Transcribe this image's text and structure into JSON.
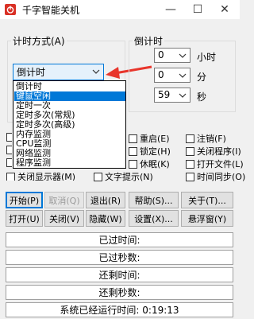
{
  "window": {
    "title": "千字智能关机",
    "min_glyph": "—",
    "max_glyph": "☐",
    "close_glyph": "✕"
  },
  "timing_mode": {
    "label": "计时方式(A)",
    "selected": "倒计时",
    "options": [
      "倒计时",
      "键鼠空闲",
      "定时一次",
      "定时多次(常规)",
      "定时多次(高级)",
      "内存监测",
      "CPU监测",
      "网络监测",
      "程序监测"
    ],
    "highlighted_index": 1
  },
  "countdown": {
    "label": "倒计时",
    "hours": {
      "value": "0",
      "unit": "小时"
    },
    "minutes": {
      "value": "0",
      "unit": "分"
    },
    "seconds": {
      "value": "59",
      "unit": "秒"
    }
  },
  "actions": {
    "restart": "重启(E)",
    "lock": "锁定(H)",
    "sleep": "休眠(K)",
    "text_prompt": "文字提示(N)",
    "partial_left": "关闭显示器(M)",
    "logout": "注销(F)",
    "close_program": "关闭程序(I)",
    "open_file": "打开文件(L)",
    "time_sync": "时间同步(O)"
  },
  "buttons": {
    "start": "开始(P)",
    "cancel": "取消(Q)",
    "exit": "退出(R)",
    "help": "帮助(S)...",
    "about": "关于(T)...",
    "open": "打开(U)",
    "close": "关闭(V)",
    "hide": "隐藏(W)",
    "settings": "设置(X)...",
    "float": "悬浮窗(Y)"
  },
  "status": {
    "elapsed_time": "已过时间:",
    "elapsed_seconds": "已过秒数:",
    "remaining_time": "还剩时间:",
    "remaining_seconds": "还剩秒数:",
    "system_uptime_label": "系统已经运行时间:",
    "system_uptime_value": "0:19:13"
  },
  "colors": {
    "highlight": "#0078d7",
    "arrow": "#e8362c"
  }
}
